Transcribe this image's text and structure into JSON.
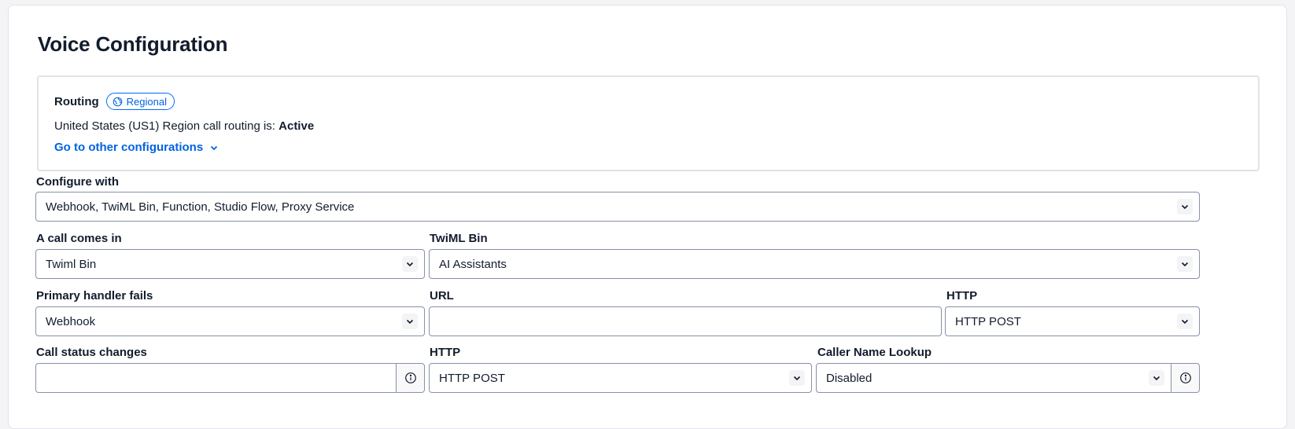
{
  "page": {
    "title": "Voice Configuration"
  },
  "routing": {
    "label": "Routing",
    "badge": "Regional",
    "status_prefix": "United States (US1) Region call routing is: ",
    "status_value": "Active",
    "link": "Go to other configurations"
  },
  "configure_with": {
    "label": "Configure with",
    "value": "Webhook, TwiML Bin, Function, Studio Flow, Proxy Service"
  },
  "call_comes_in": {
    "label": "A call comes in",
    "value": "Twiml Bin"
  },
  "twiml_bin": {
    "label": "TwiML Bin",
    "value": "AI Assistants"
  },
  "primary_handler": {
    "label": "Primary handler fails",
    "value": "Webhook"
  },
  "url": {
    "label": "URL",
    "value": ""
  },
  "http_primary": {
    "label": "HTTP",
    "value": "HTTP POST"
  },
  "call_status": {
    "label": "Call status changes",
    "value": ""
  },
  "http_status": {
    "label": "HTTP",
    "value": "HTTP POST"
  },
  "caller_name": {
    "label": "Caller Name Lookup",
    "value": "Disabled"
  },
  "colors": {
    "link": "#0263e0",
    "border": "#8891aa",
    "text": "#121c2d"
  }
}
